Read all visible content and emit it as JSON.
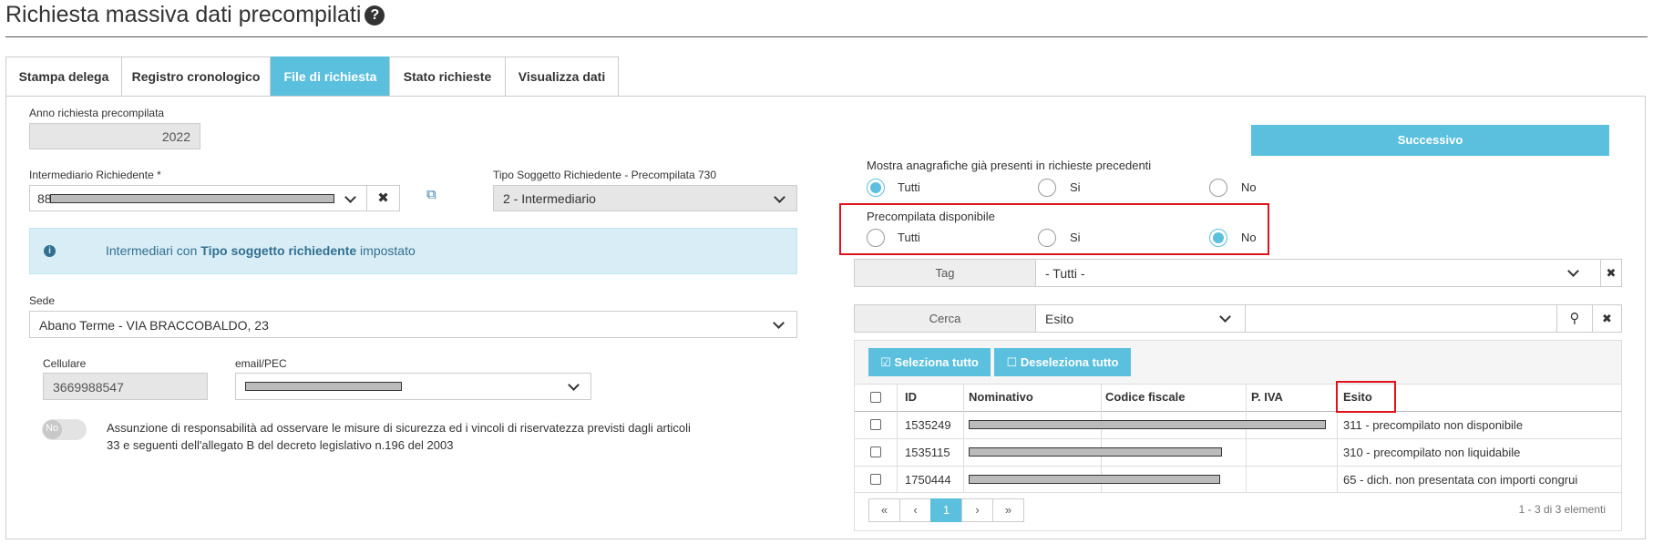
{
  "page_title": "Richiesta massiva dati precompilati",
  "tabs": [
    "Stampa delega",
    "Registro cronologico",
    "File di richiesta",
    "Stato richieste",
    "Visualizza dati"
  ],
  "active_tab": "File di richiesta",
  "anno": {
    "label": "Anno richiesta precompilata",
    "value": "2022"
  },
  "intermediario": {
    "label": "Intermediario Richiedente *",
    "value": "88"
  },
  "tipo_soggetto": {
    "label": "Tipo Soggetto Richiedente - Precompilata 730",
    "value": "2 - Intermediario"
  },
  "info": {
    "prefix": "Intermediari con ",
    "bold": "Tipo soggetto richiedente",
    "suffix": " impostato"
  },
  "sede": {
    "label": "Sede",
    "value": "Abano Terme - VIA BRACCOBALDO, 23"
  },
  "cellulare": {
    "label": "Cellulare",
    "value": "3669988547"
  },
  "email": {
    "label": "email/PEC"
  },
  "toggle": {
    "label": "No",
    "text_line1": "Assunzione di responsabilità ad osservare le misure di sicurezza ed i vincoli di riservatezza previsti dagli articoli",
    "text_line2": "33 e seguenti dell'allegato B del decreto legislativo n.196 del 2003"
  },
  "successivo": "Successivo",
  "mostra": {
    "label": "Mostra anagrafiche già presenti in richieste precedenti",
    "options": [
      "Tutti",
      "Si",
      "No"
    ],
    "selected": "Tutti"
  },
  "precompilata": {
    "label": "Precompilata disponibile",
    "options": [
      "Tutti",
      "Si",
      "No"
    ],
    "selected": "No"
  },
  "tag": {
    "label": "Tag",
    "value": "- Tutti -"
  },
  "cerca": {
    "label": "Cerca",
    "field": "Esito",
    "query": ""
  },
  "seleziona_tutto": "Seleziona tutto",
  "deseleziona_tutto": "Deseleziona tutto",
  "table": {
    "columns": [
      "ID",
      "Nominativo",
      "Codice fiscale",
      "P. IVA",
      "Esito"
    ],
    "rows": [
      {
        "id": "1535249",
        "esito": "311 - precompilato non disponibile"
      },
      {
        "id": "1535115",
        "esito": "310 - precompilato non liquidabile"
      },
      {
        "id": "1750444",
        "esito": "65 - dich. non presentata con importi congrui"
      }
    ]
  },
  "pagination": {
    "first": "«",
    "prev": "‹",
    "current": "1",
    "next": "›",
    "last": "»",
    "summary": "1 - 3 di 3 elementi"
  },
  "colors": {
    "accent": "#5bc0de",
    "highlight_box": "#e0121b",
    "info_bg": "#d9edf7"
  }
}
